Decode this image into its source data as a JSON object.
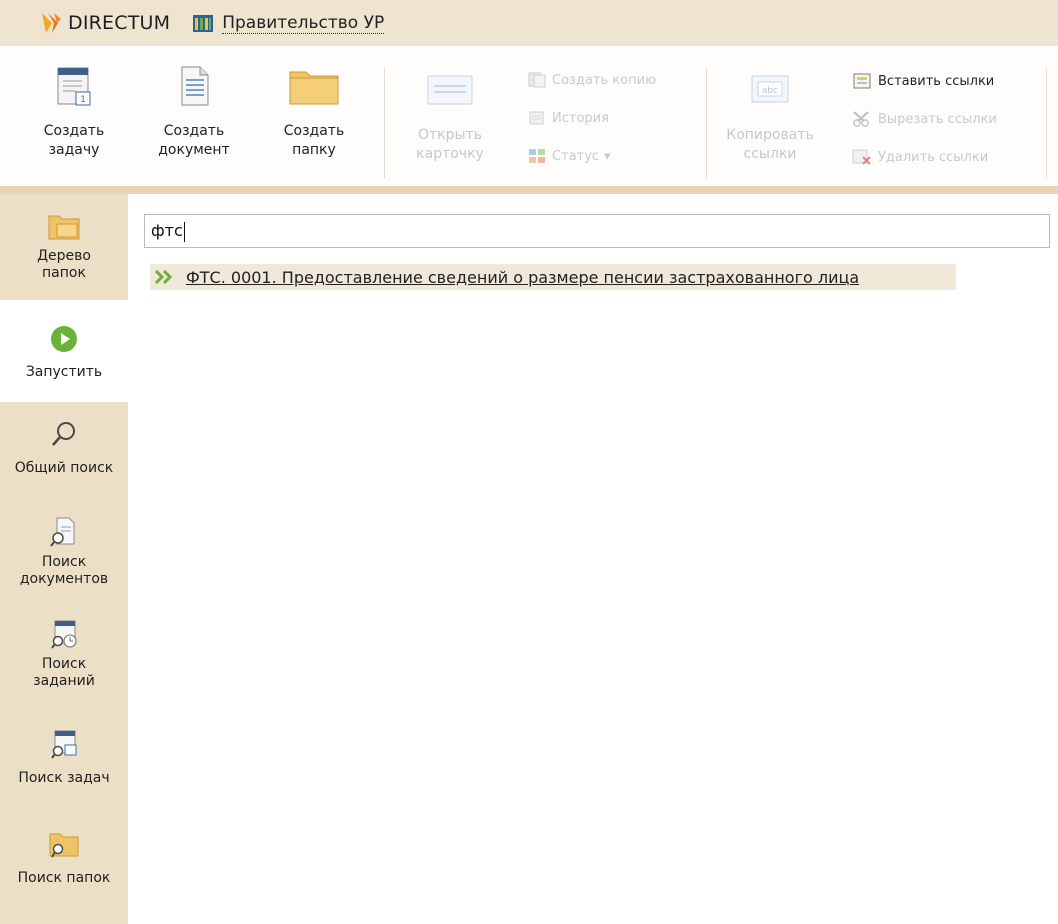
{
  "titlebar": {
    "app_name": "DIRECTUM",
    "org_name": "Правительство УР"
  },
  "ribbon": {
    "create_task": "Создать задачу",
    "create_document": "Создать документ",
    "create_folder": "Создать папку",
    "open_card": "Открыть карточку",
    "create_copy": "Создать копию",
    "history": "История",
    "status": "Статус",
    "copy_links": "Копировать ссылки",
    "paste_links": "Вставить ссылки",
    "cut_links": "Вырезать ссылки",
    "delete_links": "Удалить ссылки"
  },
  "sidebar": {
    "folder_tree": "Дерево папок",
    "run": "Запустить",
    "general_search": "Общий поиск",
    "search_documents": "Поиск документов",
    "search_assignments": "Поиск заданий",
    "search_tasks": "Поиск задач",
    "search_folders": "Поиск папок"
  },
  "search": {
    "value": "фтс"
  },
  "results": [
    {
      "title": "ФТС. 0001. Предоставление сведений о размере пенсии застрахованного лица"
    }
  ],
  "colors": {
    "title_bg": "#efe4cf",
    "sidebar_bg": "#ebdfc6",
    "result_bg": "#f0e8d8",
    "accent_green": "#6ab23a",
    "logo_orange": "#f28a1e"
  }
}
